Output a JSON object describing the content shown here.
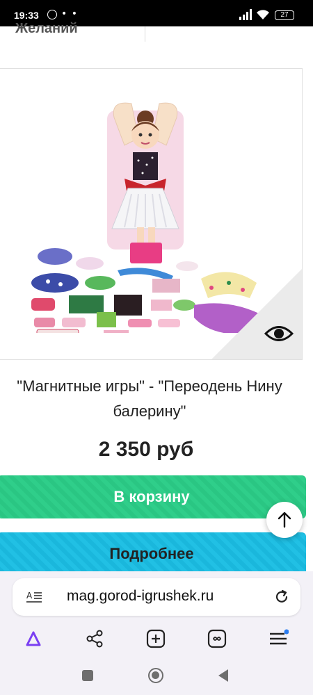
{
  "status_bar": {
    "time": "19:33",
    "dots": "• •",
    "battery": "27",
    "icons": [
      "whatsapp-icon",
      "signal-icon",
      "wifi-icon",
      "battery-icon"
    ]
  },
  "page": {
    "wishlist_label": "Желаний",
    "product": {
      "title_line1": "\"Магнитные игры\" - \"Переодень Нину",
      "title_line2": "балерину\"",
      "price": "2 350 руб",
      "image_alt": "Magnetic dress-up ballerina doll set",
      "quick_view_icon": "eye-icon"
    },
    "buttons": {
      "cart": "В корзину",
      "more": "Подробнее",
      "scroll_top_icon": "arrow-up-icon"
    },
    "colors": {
      "cart_green": "#2ac683",
      "more_blue": "#1ab7dc"
    }
  },
  "browser": {
    "url": "mag.gorod-igrushek.ru",
    "toolbar_icons": [
      "alice-icon",
      "share-icon",
      "new-tab-icon",
      "tabs-icon",
      "menu-icon"
    ],
    "accent": "#7a3ff2"
  },
  "system_nav": [
    "recents-button",
    "home-button",
    "back-button"
  ]
}
